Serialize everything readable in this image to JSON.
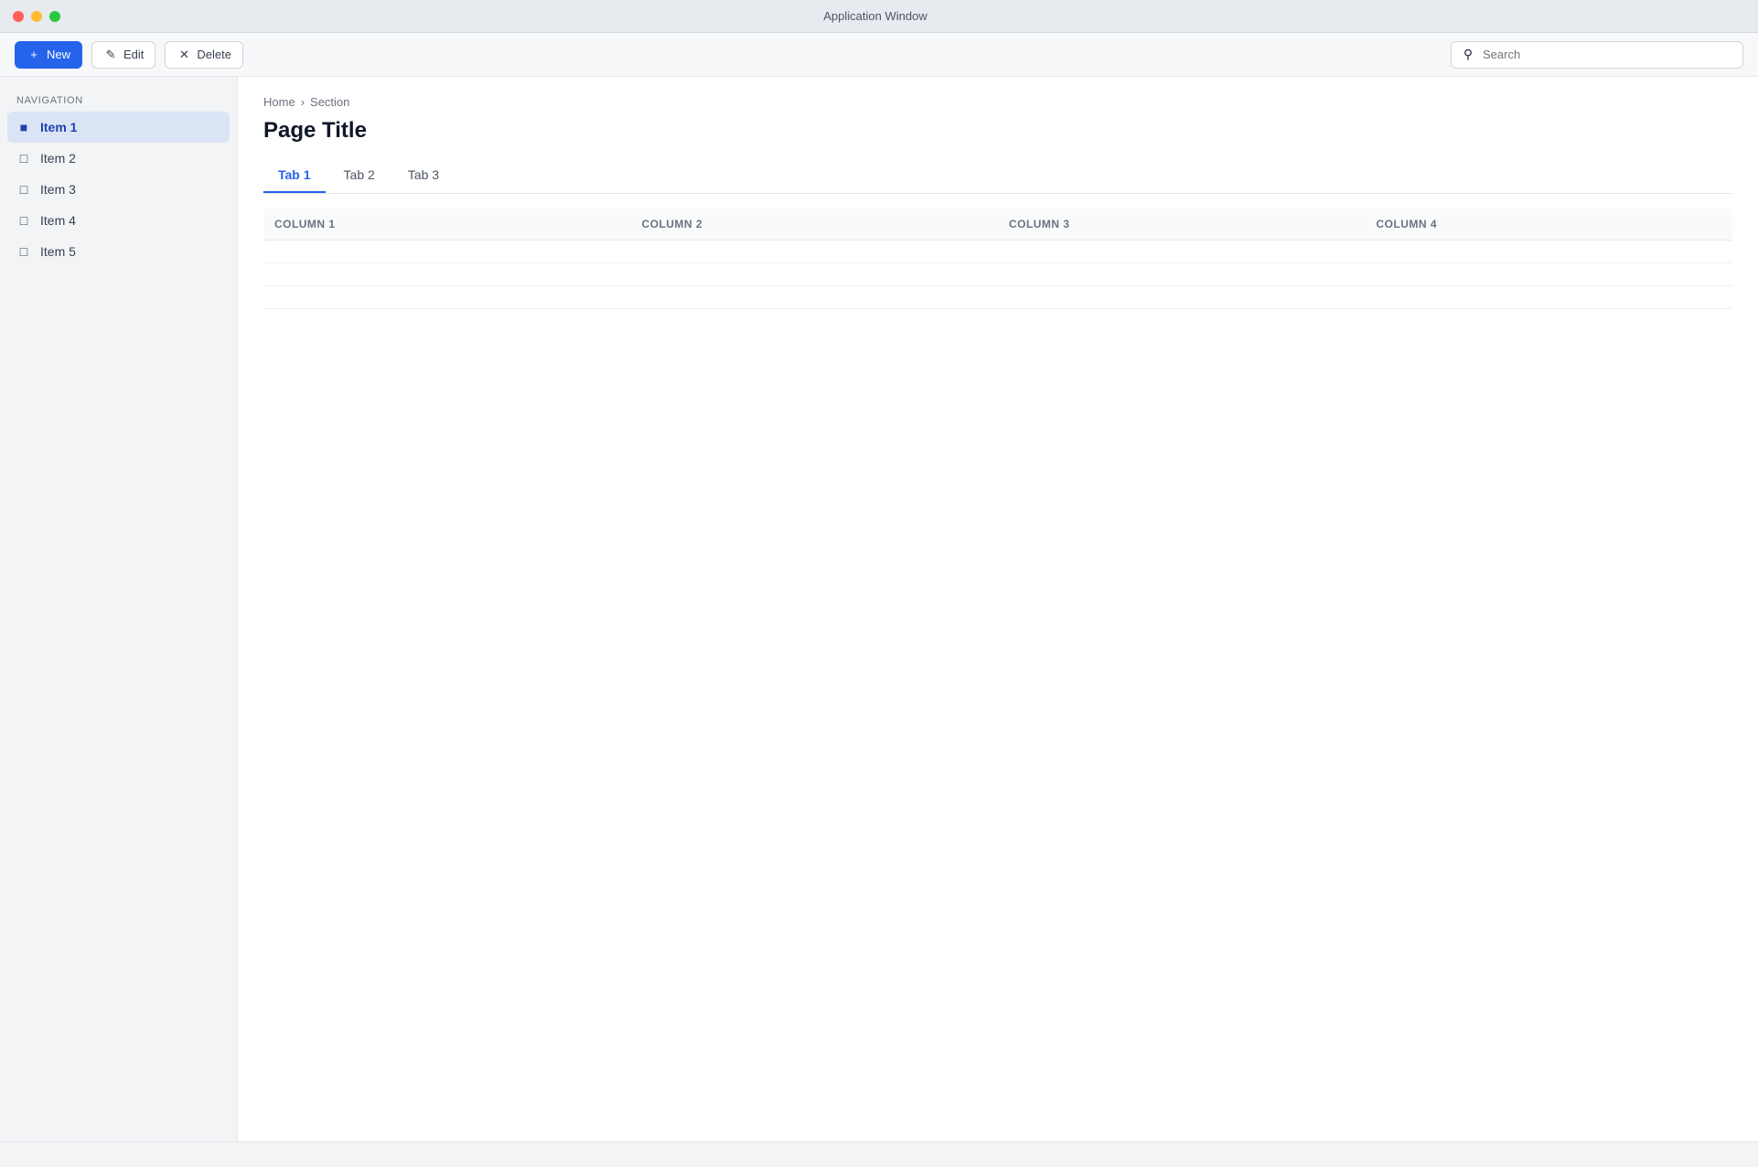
{
  "window": {
    "title": "Application Window"
  },
  "toolbar": {
    "new_label": "New",
    "edit_label": "Edit",
    "delete_label": "Delete",
    "search_placeholder": "Search"
  },
  "sidebar": {
    "heading": "Navigation",
    "items": [
      {
        "label": "Item 1",
        "count": ""
      },
      {
        "label": "Item 2",
        "count": ""
      },
      {
        "label": "Item 3",
        "count": ""
      },
      {
        "label": "Item 4",
        "count": ""
      },
      {
        "label": "Item 5",
        "count": ""
      }
    ]
  },
  "main": {
    "breadcrumb": [
      "Home",
      "Section"
    ],
    "title": "Page Title",
    "tabs": [
      {
        "label": "Tab 1"
      },
      {
        "label": "Tab 2"
      },
      {
        "label": "Tab 3"
      }
    ],
    "table": {
      "headers": [
        "Column 1",
        "Column 2",
        "Column 3",
        "Column 4"
      ],
      "rows": [
        [
          "",
          "",
          "",
          ""
        ],
        [
          "",
          "",
          "",
          ""
        ],
        [
          "",
          "",
          "",
          ""
        ]
      ]
    }
  },
  "statusbar": {
    "left": "",
    "right": ""
  },
  "colors": {
    "accent": "#2563eb"
  }
}
